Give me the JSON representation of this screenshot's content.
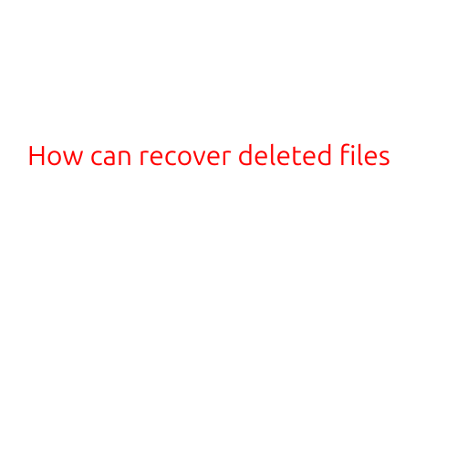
{
  "heading": "How can recover deleted files"
}
